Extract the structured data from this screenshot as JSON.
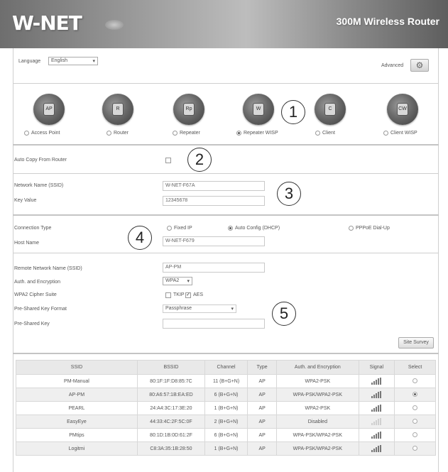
{
  "header": {
    "logo": "W-NET",
    "product": "300M Wireless Router"
  },
  "language": {
    "label": "Language",
    "value": "English"
  },
  "advanced": {
    "label": "Advanced"
  },
  "modes": [
    {
      "label": "Access Point",
      "selected": false
    },
    {
      "label": "Router",
      "selected": false
    },
    {
      "label": "Repeater",
      "selected": false
    },
    {
      "label": "Repeater WISP",
      "selected": true
    },
    {
      "label": "Client",
      "selected": false
    },
    {
      "label": "Client WISP",
      "selected": false
    }
  ],
  "callouts": [
    "1",
    "2",
    "3",
    "4",
    "5"
  ],
  "auto_copy": {
    "label": "Auto Copy From Router",
    "checked": false
  },
  "network": {
    "ssid_label": "Network Name (SSID)",
    "ssid_value": "W-NET-F67A",
    "key_label": "Key Value",
    "key_value": "12345678"
  },
  "connection": {
    "label": "Connection Type",
    "options": [
      {
        "label": "Fixed IP",
        "selected": false
      },
      {
        "label": "Auto Config (DHCP)",
        "selected": true
      },
      {
        "label": "PPPoE Dial-Up",
        "selected": false
      }
    ],
    "host_label": "Host Name",
    "host_value": "W-NET-F679"
  },
  "remote": {
    "ssid_label": "Remote Network Name (SSID)",
    "ssid_value": "AP-PM",
    "auth_label": "Auth. and Encryption",
    "auth_value": "WPA2",
    "cipher_label": "WPA2 Cipher Suite",
    "cipher_tkip": "TKIP",
    "cipher_tkip_checked": false,
    "cipher_aes": "AES",
    "cipher_aes_checked": true,
    "psk_format_label": "Pre-Shared Key Format",
    "psk_format_value": "Passphrase",
    "psk_label": "Pre-Shared Key",
    "psk_value": ""
  },
  "site_survey": {
    "label": "Site Survey"
  },
  "table": {
    "headers": [
      "SSID",
      "BSSID",
      "Channel",
      "Type",
      "Auth. and Encryption",
      "Signal",
      "Select"
    ],
    "rows": [
      {
        "ssid": "PM-Manual",
        "bssid": "80:1F:1F:D8:85:7C",
        "channel": "11 (B+G+N)",
        "type": "AP",
        "auth": "WPA2-PSK",
        "signal": 4,
        "selected": false
      },
      {
        "ssid": "AP-PM",
        "bssid": "80:A6:57:1B:EA:ED",
        "channel": "6 (B+G+N)",
        "type": "AP",
        "auth": "WPA-PSK/WPA2-PSK",
        "signal": 4,
        "selected": true
      },
      {
        "ssid": "PEARL",
        "bssid": "24:A4:3C:17:3E:20",
        "channel": "1 (B+G+N)",
        "type": "AP",
        "auth": "WPA2-PSK",
        "signal": 4,
        "selected": false
      },
      {
        "ssid": "EasyEye",
        "bssid": "44:33:4C:2F:5C:0F",
        "channel": "2 (B+G+N)",
        "type": "AP",
        "auth": "Disabled",
        "signal": 1,
        "selected": false
      },
      {
        "ssid": "PMtips",
        "bssid": "80:1D:1B:0D:61:2F",
        "channel": "6 (B+G+N)",
        "type": "AP",
        "auth": "WPA-PSK/WPA2-PSK",
        "signal": 4,
        "selected": false
      },
      {
        "ssid": "Logitmi",
        "bssid": "C8:3A:35:1B:28:50",
        "channel": "1 (B+G+N)",
        "type": "AP",
        "auth": "WPA-PSK/WPA2-PSK",
        "signal": 4,
        "selected": false
      }
    ]
  }
}
